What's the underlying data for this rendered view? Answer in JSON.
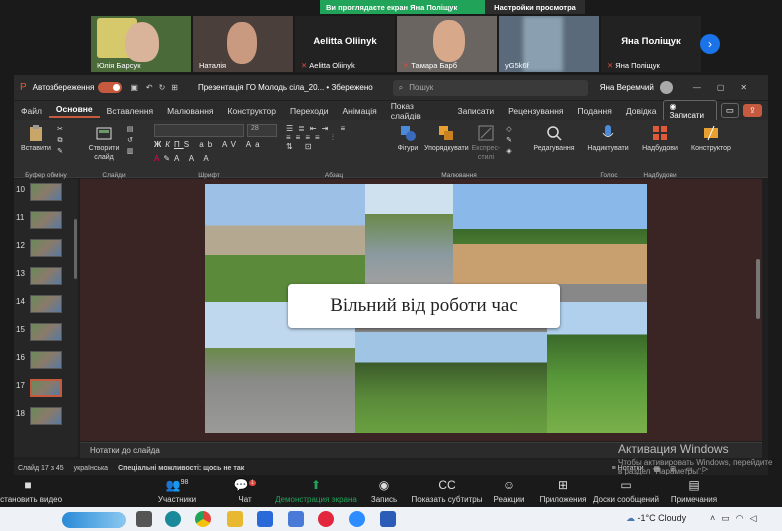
{
  "zoom": {
    "banner_text": "Ви проглядаєте екран Яна Поліщук",
    "view_options": "Настройки просмотра",
    "participants": [
      {
        "name": "Юлія Барсук",
        "muted": false
      },
      {
        "name": "Наталія",
        "muted": false
      },
      {
        "name": "Aelitta Oliinyk",
        "muted": true,
        "big": "Aelitta Oliinyk"
      },
      {
        "name": "Тамара Барб",
        "muted": true
      },
      {
        "name": "yG5k6f",
        "muted": false
      },
      {
        "name": "Яна Поліщук",
        "muted": true,
        "big": "Яна Поліщук"
      }
    ],
    "toolbar": {
      "stop_video": "Остановить видео",
      "participants": "Участники",
      "participants_count": "98",
      "chat": "Чат",
      "chat_badge": "1",
      "share_screen": "Демонстрация экрана",
      "record": "Запись",
      "captions": "Показать субтитры",
      "reactions": "Реакции",
      "apps": "Приложения",
      "whiteboards": "Доски сообщений",
      "notes": "Примечания"
    }
  },
  "ppt": {
    "autosave": "Автозбереження",
    "doc_title": "Презентація ГО Молодь сіла_20...  •  Збережено",
    "search_placeholder": "Пошук",
    "user": "Яна Веремчий",
    "tabs": [
      "Файл",
      "Основне",
      "Вставлення",
      "Малювання",
      "Конструктор",
      "Переходи",
      "Анімація",
      "Показ слайдів",
      "Записати",
      "Рецензування",
      "Подання",
      "Довідка"
    ],
    "record_btn": "Записати",
    "ribbon": {
      "paste": "Вставити",
      "new_slide": "Створити слайд",
      "shapes": "Фігури",
      "arrange": "Упорядкувати",
      "express_styles": "Експрес-стилі",
      "editing": "Редагування",
      "dictate": "Надиктувати",
      "addins": "Надбудови",
      "designer": "Конструктор",
      "font_size": "28",
      "groups": {
        "clipboard": "Буфер обміну",
        "slides": "Слайди",
        "font": "Шрифт",
        "paragraph": "Абзац",
        "drawing": "Малювання",
        "voice": "Голос",
        "addins": "Надбудови"
      }
    },
    "thumbs": [
      "10",
      "11",
      "12",
      "13",
      "14",
      "15",
      "16",
      "17",
      "18"
    ],
    "slide_title": "Вільний від роботи час",
    "notes": "Нотатки до слайда",
    "status": {
      "slide": "Слайд 17 з 45",
      "lang": "українська",
      "accessibility": "Спеціальні можливості: щось не так",
      "notes_btn": "Нотатки"
    }
  },
  "activation": {
    "title": "Активация Windows",
    "subtitle": "Чтобы активировать Windows, перейдите в раздел \"Параметры\"."
  },
  "taskbar": {
    "weather": "-1°C  Cloudy"
  },
  "colors": {
    "zoom_green": "#22a35a",
    "ppt_accent": "#c55a3f",
    "slide_bg": "#3b2424"
  }
}
